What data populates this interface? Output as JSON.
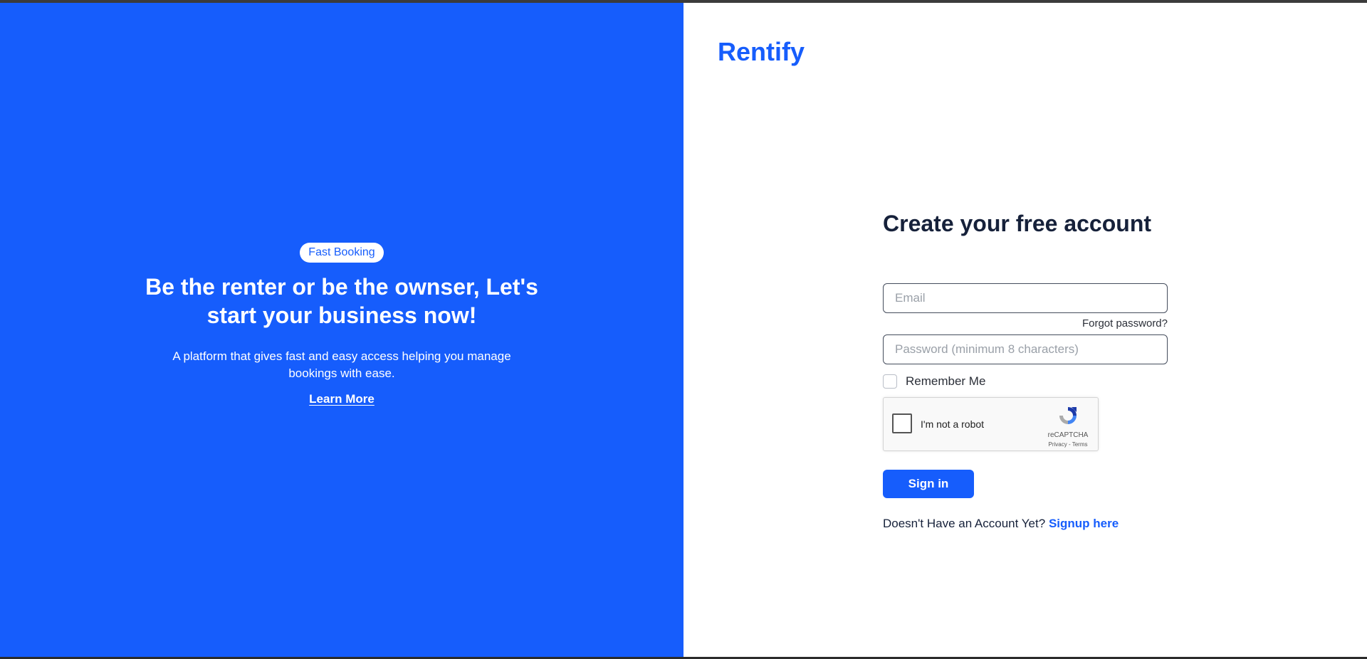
{
  "brand": {
    "name": "Rentify"
  },
  "hero": {
    "badge": "Fast Booking",
    "title": "Be the renter or be the ownser, Let's start your business now!",
    "description": "A platform that gives fast and easy access helping you manage bookings with ease.",
    "learn_more": "Learn More"
  },
  "form": {
    "title": "Create your free account",
    "email_placeholder": "Email",
    "forgot_password": "Forgot password?",
    "password_placeholder": "Password (minimum 8 characters)",
    "remember_me": "Remember Me",
    "captcha": {
      "label": "I'm not a robot",
      "brand": "reCAPTCHA",
      "links": "Privacy - Terms"
    },
    "signin_label": "Sign in",
    "signup_prompt": "Doesn't Have an Account Yet?",
    "signup_link": "Signup here"
  },
  "colors": {
    "primary": "#165dfc",
    "heading": "#16213a",
    "white": "#ffffff"
  }
}
